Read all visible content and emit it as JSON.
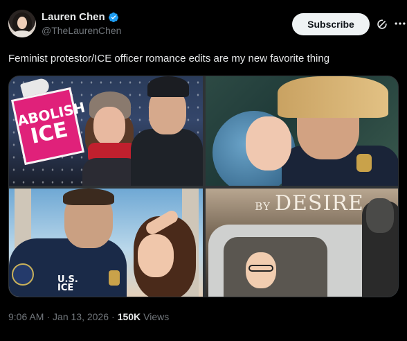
{
  "author": {
    "display_name": "Lauren Chen",
    "handle": "@TheLaurenChen",
    "verified": true,
    "verified_color": "#1d9bf0"
  },
  "header": {
    "subscribe_label": "Subscribe",
    "grok_icon": "grok-icon",
    "more_icon": "more-icon"
  },
  "tweet": {
    "text": "Feminist protestor/ICE officer romance edits are my new favorite thing"
  },
  "media": {
    "images": [
      {
        "sign_line1": "ABOLISH",
        "sign_line2": "ICE"
      },
      {},
      {
        "uniform_text_line1": "U.S.",
        "uniform_text_line2": "ICE"
      },
      {
        "title_line1": "BY",
        "title_line2": "DESIRE"
      }
    ]
  },
  "meta": {
    "time": "9:06 AM",
    "separator1": "·",
    "date": "Jan 13, 2026",
    "separator2": "·",
    "views_count": "150K",
    "views_label": "Views"
  }
}
